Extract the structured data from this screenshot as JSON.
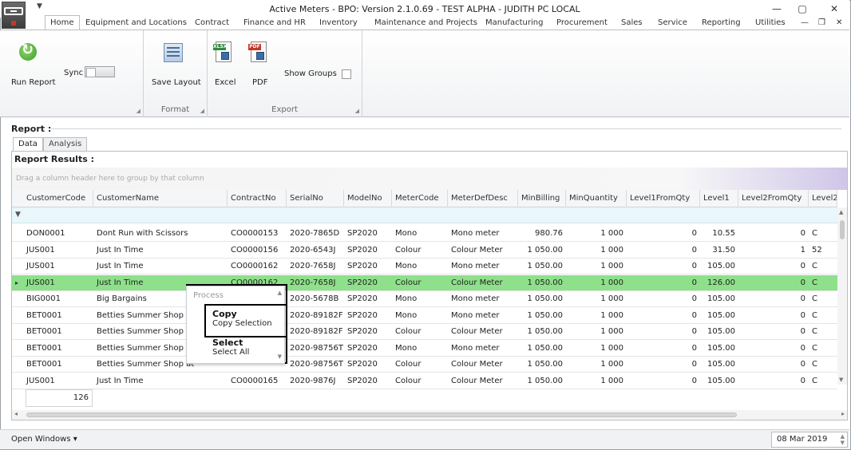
{
  "window": {
    "title": "Active Meters - BPO: Version 2.1.0.69 - TEST ALPHA - JUDITH PC LOCAL",
    "minimize": "—",
    "restore": "▢",
    "close": "✕"
  },
  "ribbon_tabs": [
    "Home",
    "Equipment and Locations",
    "Contract",
    "Finance and HR",
    "Inventory",
    "Maintenance and Projects",
    "Manufacturing",
    "Procurement",
    "Sales",
    "Service",
    "Reporting",
    "Utilities"
  ],
  "ribbon": {
    "run_report": "Run Report",
    "sync": "Sync",
    "save_layout": "Save Layout",
    "format_group": "Format",
    "excel": "Excel",
    "pdf": "PDF",
    "show_groups": "Show Groups",
    "export_group": "Export",
    "xlsx_tag": "XLSX",
    "pdf_tag": "PDF"
  },
  "report": {
    "label": "Report :",
    "tabs": [
      "Data",
      "Analysis"
    ],
    "results_label": "Report Results :",
    "groupby_hint": "Drag a column header here to group by that column"
  },
  "grid": {
    "columns": [
      "CustomerCode",
      "CustomerName",
      "ContractNo",
      "SerialNo",
      "ModelNo",
      "MeterCode",
      "MeterDefDesc",
      "MinBilling",
      "MinQuantity",
      "Level1FromQty",
      "Level1",
      "Level2FromQty",
      "Level2"
    ],
    "rows": [
      [
        "DON0001",
        "Dont Run with Scissors",
        "CO0000153",
        "2020-7865D",
        "SP2020",
        "Mono",
        "Mono meter",
        "980.76",
        "1 000",
        "0",
        "10.55",
        "0",
        "C"
      ],
      [
        "JUS001",
        "Just In Time",
        "CO0000156",
        "2020-6543J",
        "SP2020",
        "Colour",
        "Colour Meter",
        "1 050.00",
        "1 000",
        "0",
        "31.50",
        "1",
        "52"
      ],
      [
        "JUS001",
        "Just In Time",
        "CO0000162",
        "2020-7658J",
        "SP2020",
        "Mono",
        "Mono meter",
        "1 050.00",
        "1 000",
        "0",
        "105.00",
        "0",
        "C"
      ],
      [
        "JUS001",
        "Just In Time",
        "CO0000162",
        "2020-7658J",
        "SP2020",
        "Colour",
        "Colour Meter",
        "1 050.00",
        "1 000",
        "0",
        "126.00",
        "0",
        "C"
      ],
      [
        "BIG0001",
        "Big Bargains",
        "",
        "2020-5678B",
        "SP2020",
        "Mono",
        "Mono meter",
        "1 050.00",
        "1 000",
        "0",
        "105.00",
        "0",
        "C"
      ],
      [
        "BET0001",
        "Betties Summer Shop at",
        "",
        "2020-89182F",
        "SP2020",
        "Mono",
        "Mono meter",
        "1 050.00",
        "1 000",
        "0",
        "105.00",
        "0",
        "C"
      ],
      [
        "BET0001",
        "Betties Summer Shop at",
        "",
        "2020-89182F",
        "SP2020",
        "Colour",
        "Colour Meter",
        "1 050.00",
        "1 000",
        "0",
        "105.00",
        "0",
        "C"
      ],
      [
        "BET0001",
        "Betties Summer Shop at",
        "",
        "2020-98756T",
        "SP2020",
        "Mono",
        "Mono meter",
        "1 050.00",
        "1 000",
        "0",
        "105.00",
        "0",
        "C"
      ],
      [
        "BET0001",
        "Betties Summer Shop at",
        "",
        "2020-98756T",
        "SP2020",
        "Colour",
        "Colour Meter",
        "1 050.00",
        "1 000",
        "0",
        "105.00",
        "0",
        "C"
      ],
      [
        "JUS001",
        "Just In Time",
        "CO0000165",
        "2020-9876J",
        "SP2020",
        "Colour",
        "Colour Meter",
        "1 050.00",
        "1 000",
        "0",
        "105.00",
        "0",
        "C"
      ]
    ],
    "selected_row": 3,
    "row_count": "126"
  },
  "context_menu": {
    "section": "Process",
    "copy_head": "Copy",
    "copy_selection": "Copy Selection",
    "select_head": "Select",
    "select_all": "Select All"
  },
  "status": {
    "open_windows": "Open Windows ▾",
    "date": "08 Mar 2019"
  },
  "colors": {
    "selected_row": "#8ee08a",
    "filter_row": "#e9f6fb"
  }
}
